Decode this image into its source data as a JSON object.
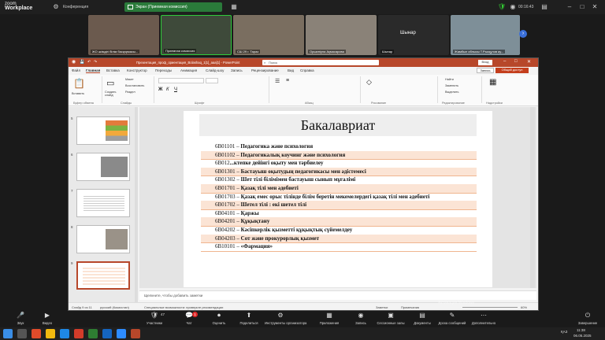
{
  "zoom": {
    "logo_line1": "zoom",
    "logo_line2": "Workplace",
    "conference_label": "Конференция",
    "screen_pill": "Экран (Приемная комиссия)",
    "timer": "00:16:43",
    "participants_tiles": [
      {
        "name": "ЖО әкімдігі білім басқармасы...",
        "color": "#6b5a4e"
      },
      {
        "name": "Приемная комиссия",
        "color": "#3e4a3a"
      },
      {
        "name": "СШ 29 г. Тараз",
        "color": "#7a6e60"
      },
      {
        "name": "Оршиніула Ақмасарова",
        "color": "#8a8278"
      },
      {
        "name": "Шынар",
        "color": "#2a2a2a"
      },
      {
        "name": "Жамбыл облысы Т.Рысқұлов ау...",
        "color": "#7e8f98"
      }
    ],
    "center_tile_label": "Шынар",
    "bottom": [
      {
        "icon": "🎤",
        "label": "Звук"
      },
      {
        "icon": "▶",
        "label": "Видео"
      },
      {
        "icon": "🛡",
        "label": "Участники"
      },
      {
        "icon": "💬",
        "label": "Чат"
      },
      {
        "icon": "⏺",
        "label": "Оценить"
      },
      {
        "icon": "⬆",
        "label": "Поделиться"
      },
      {
        "icon": "⚙",
        "label": "Инструменты организатора"
      },
      {
        "icon": "▦",
        "label": "Приложения"
      },
      {
        "icon": "◉",
        "label": "Запись"
      },
      {
        "icon": "▣",
        "label": "Сессионные залы"
      },
      {
        "icon": "▤",
        "label": "Документы"
      },
      {
        "icon": "✎",
        "label": "Доска сообщений"
      },
      {
        "icon": "⋯",
        "label": "Дополнительно"
      }
    ],
    "participants_count": "47",
    "chat_badge": "1",
    "end_label": "Завершение",
    "watermark": "Активация Windows"
  },
  "ppt": {
    "title": "Презентация_проф_ориентация_Bolashaq_1[1]_aaa[1] - PowerPoint",
    "search_placeholder": "Поиск",
    "login": "Вход",
    "menu_tabs": [
      "Файл",
      "Главная",
      "Вставка",
      "Конструктор",
      "Переходы",
      "Анимация",
      "Слайд-шоу",
      "Запись",
      "Рецензирование",
      "Вид",
      "Справка"
    ],
    "active_tab": "Главная",
    "record_btn": "Запись",
    "share_btn": "Общий доступ",
    "ribbon_groups": [
      "Буфер обмена",
      "Слайды",
      "Шрифт",
      "Абзац",
      "Рисование",
      "Редактирование",
      "Надстройки"
    ],
    "ribbon_buttons": {
      "paste": "Вставить",
      "new_slide": "Создать слайд",
      "layout": "Макет",
      "reset": "Восстановить",
      "section": "Раздел",
      "find": "Найти",
      "replace": "Заменить",
      "select": "Выделить",
      "addins": "Надстройки"
    },
    "thumbnails": [
      "5",
      "6",
      "7",
      "8",
      "9"
    ],
    "slide": {
      "title": "Бакалавриат",
      "rows": [
        {
          "code": "6B01101 – ",
          "name": "Педагогика және психология"
        },
        {
          "code": "6B01102 – ",
          "name": "Педагогикалық коучинг және психология"
        },
        {
          "code": "6B012",
          "name": "...ктепке дейінгі оқыту мен тәрбиелеу"
        },
        {
          "code": "6B01301 – ",
          "name": "Бастауыш оқытудың педагогикасы мен әдістемесі"
        },
        {
          "code": "6B01302 – ",
          "name": "Шет тілі білімімен бастауыш сынып мұғалімі"
        },
        {
          "code": "6B01701 – ",
          "name": "Қазақ тілі мен әдебиеті"
        },
        {
          "code": "6B01703 – ",
          "name": "Қазақ емес орыс тілінде білім беретін мекемелердегі қазақ тілі мен әдебиеті"
        },
        {
          "code": "6B01702 – ",
          "name": "Шетел тілі : екі шетел тілі"
        },
        {
          "code": "6B04101 – ",
          "name": "Қаржы"
        },
        {
          "code": "6B04201 – ",
          "name": "Құқықтану"
        },
        {
          "code": "6B04202 – ",
          "name": "Кәсіпкерлік қызметті құқықтық сүйемелдеу"
        },
        {
          "code": "6B04203 – ",
          "name": "Сот және прокурорлық қызмет"
        },
        {
          "code": "6B10101 – ",
          "name": "«Фармация»"
        }
      ],
      "tooltip": "Бакалавриат"
    },
    "notes_placeholder": "Щелкните, чтобы добавить заметки",
    "status": {
      "slide_count": "Слайд 9 из 11",
      "language": "русский (Казахстан)",
      "accessibility": "Специальные возможности: проверьте рекомендации",
      "notes": "Заметки",
      "comments": "Примечания",
      "zoom": "60%"
    }
  },
  "taskbar": {
    "time": "11:38",
    "date": "06.05.2025",
    "lang": "ҚАЗ"
  }
}
